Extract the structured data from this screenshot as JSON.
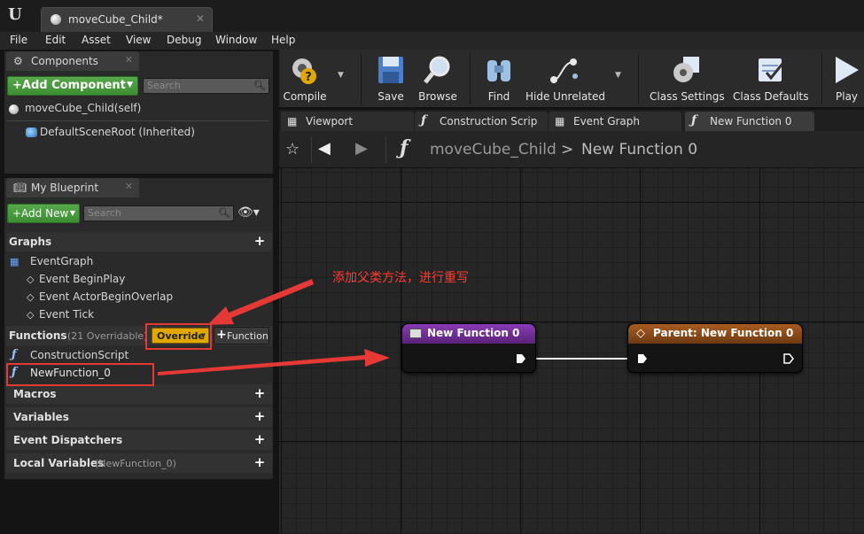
{
  "window": {
    "doc_tab_title": "moveCube_Child*",
    "menu": [
      "File",
      "Edit",
      "Asset",
      "View",
      "Debug",
      "Window",
      "Help"
    ]
  },
  "components_panel": {
    "tab_label": "Components",
    "add_button": "+Add Component",
    "search_placeholder": "Search",
    "self_item": "moveCube_Child(self)",
    "root_item": "DefaultSceneRoot (Inherited)"
  },
  "my_blueprint": {
    "tab_label": "My Blueprint",
    "add_new_button": "+Add New",
    "search_placeholder": "Search",
    "graphs_label": "Graphs",
    "event_graph_label": "EventGraph",
    "events": [
      "Event BeginPlay",
      "Event ActorBeginOverlap",
      "Event Tick"
    ],
    "functions_label": "Functions",
    "functions_overridable": "(21 Overridable)",
    "override_button": "Override",
    "function_button": "Function",
    "functions": [
      "ConstructionScript",
      "NewFunction_0"
    ],
    "macros_label": "Macros",
    "variables_label": "Variables",
    "dispatchers_label": "Event Dispatchers",
    "local_vars_label": "Local Variables",
    "local_vars_sub": "(NewFunction_0)"
  },
  "toolbar": {
    "buttons": [
      "Compile",
      "Save",
      "Browse",
      "Find",
      "Hide Unrelated",
      "Class Settings",
      "Class Defaults",
      "Play"
    ]
  },
  "graph_tabs": [
    "Viewport",
    "Construction Scrip",
    "Event Graph",
    "New Function 0"
  ],
  "breadcrumb": {
    "root": "moveCube_Child",
    "separator": ">",
    "current": "New Function 0"
  },
  "nodes": {
    "entry_title": "New Function 0",
    "parent_title": "Parent: New Function 0"
  },
  "annotation": {
    "text": "添加父类方法，进行重写"
  },
  "colors": {
    "entry_header": "#6b2a8f",
    "parent_header": "#8a4a17",
    "annotation": "#e53935",
    "override_yellow": "#e0a800",
    "add_green": "#4a9a3e"
  }
}
